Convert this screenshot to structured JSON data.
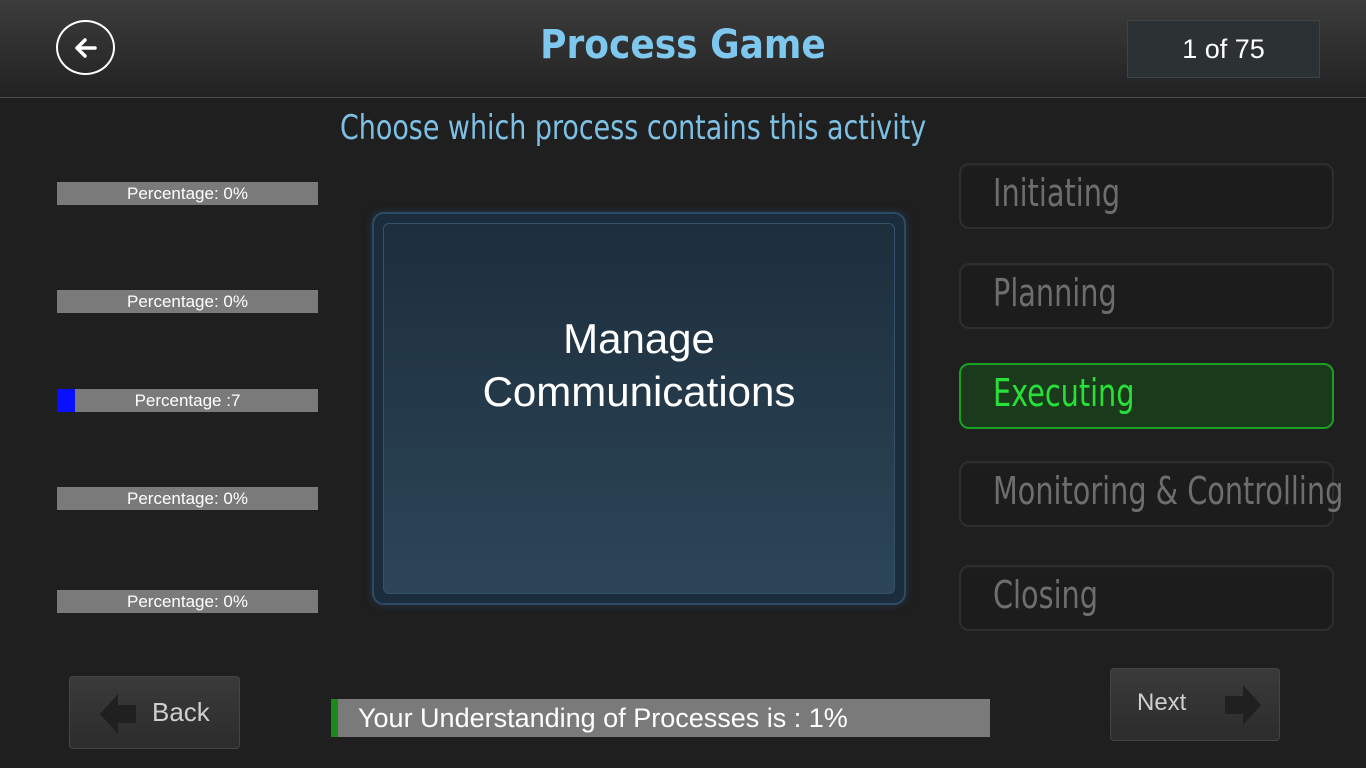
{
  "header": {
    "title": "Process Game",
    "counter": "1 of 75"
  },
  "instruction": "Choose which process contains this activity",
  "progress_bars": [
    {
      "label": "Percentage: 0%",
      "value": 0
    },
    {
      "label": "Percentage: 0%",
      "value": 0
    },
    {
      "label": "Percentage :7",
      "value": 7
    },
    {
      "label": "Percentage: 0%",
      "value": 0
    },
    {
      "label": "Percentage: 0%",
      "value": 0
    }
  ],
  "activity_card": {
    "text": "Manage Communications"
  },
  "options": [
    {
      "label": "Initiating",
      "selected": false
    },
    {
      "label": "Planning",
      "selected": false
    },
    {
      "label": "Executing",
      "selected": true
    },
    {
      "label": "Monitoring & Controlling",
      "selected": false
    },
    {
      "label": "Closing",
      "selected": false
    }
  ],
  "footer": {
    "back_label": "Back",
    "next_label": "Next",
    "understanding_text": "Your Understanding of Processes is : 1%",
    "understanding_value": 1
  },
  "colors": {
    "title": "#7ec8ef",
    "selected_option": "#28e03a",
    "progress_fill": "#0a10ff",
    "understanding_fill": "#1a8a1a"
  },
  "icons": {
    "header_back": "arrow-left-icon",
    "back_button": "arrow-left-icon",
    "next_button": "arrow-right-icon"
  }
}
